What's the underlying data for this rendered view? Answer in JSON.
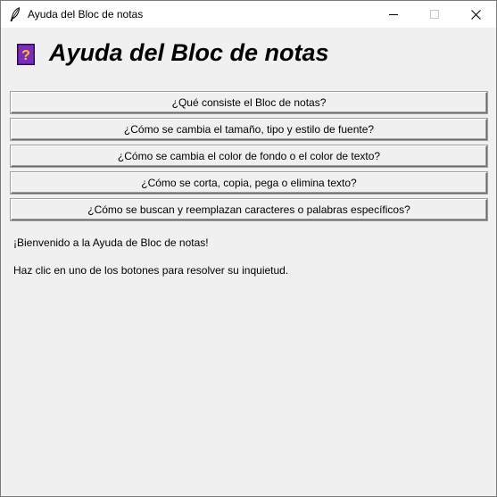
{
  "window": {
    "title": "Ayuda del Bloc de notas",
    "app_icon": "feather-icon",
    "controls": [
      "minimize-icon",
      "maximize-icon",
      "close-icon"
    ]
  },
  "header": {
    "icon": "help-book-icon",
    "title": "Ayuda del Bloc de notas"
  },
  "questions": [
    {
      "label": "¿Qué consiste el Bloc de notas?"
    },
    {
      "label": "¿Cómo se cambia el tamaño, tipo y estilo de fuente?"
    },
    {
      "label": "¿Cómo se cambia el color de fondo o el color de texto?"
    },
    {
      "label": "¿Cómo se corta, copia, pega o elimina texto?"
    },
    {
      "label": "¿Cómo se buscan y reemplazan caracteres o palabras específicos?"
    }
  ],
  "messages": {
    "welcome": "¡Bienvenido a la Ayuda de Bloc de notas!",
    "instruction": "Haz clic en uno de los botones para resolver su inquietud."
  },
  "colors": {
    "background": "#f0f0f0",
    "titlebar": "#ffffff",
    "book_purple": "#6a1b9a",
    "book_yellow": "#f5c518"
  }
}
